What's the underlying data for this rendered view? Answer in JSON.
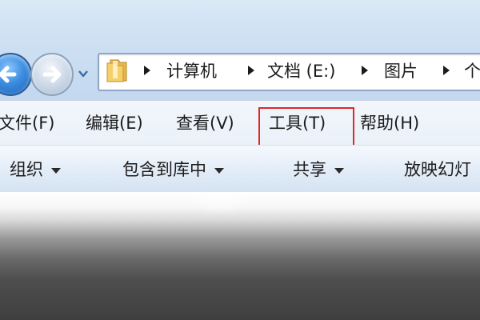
{
  "navigation": {
    "back_icon": "back-arrow-icon",
    "forward_icon": "forward-arrow-icon",
    "history_icon": "chevron-down-icon"
  },
  "address": {
    "folder_icon": "folder-icon",
    "crumbs": [
      "计算机",
      "文档 (E:)",
      "图片",
      "个"
    ]
  },
  "menu": {
    "items": [
      "文件(F)",
      "编辑(E)",
      "查看(V)",
      "工具(T)",
      "帮助(H)"
    ],
    "highlighted": "工具(T)",
    "highlight_color": "#e0282b"
  },
  "toolbar": {
    "items": [
      "组织",
      "包含到库中",
      "共享",
      "放映幻灯"
    ]
  }
}
